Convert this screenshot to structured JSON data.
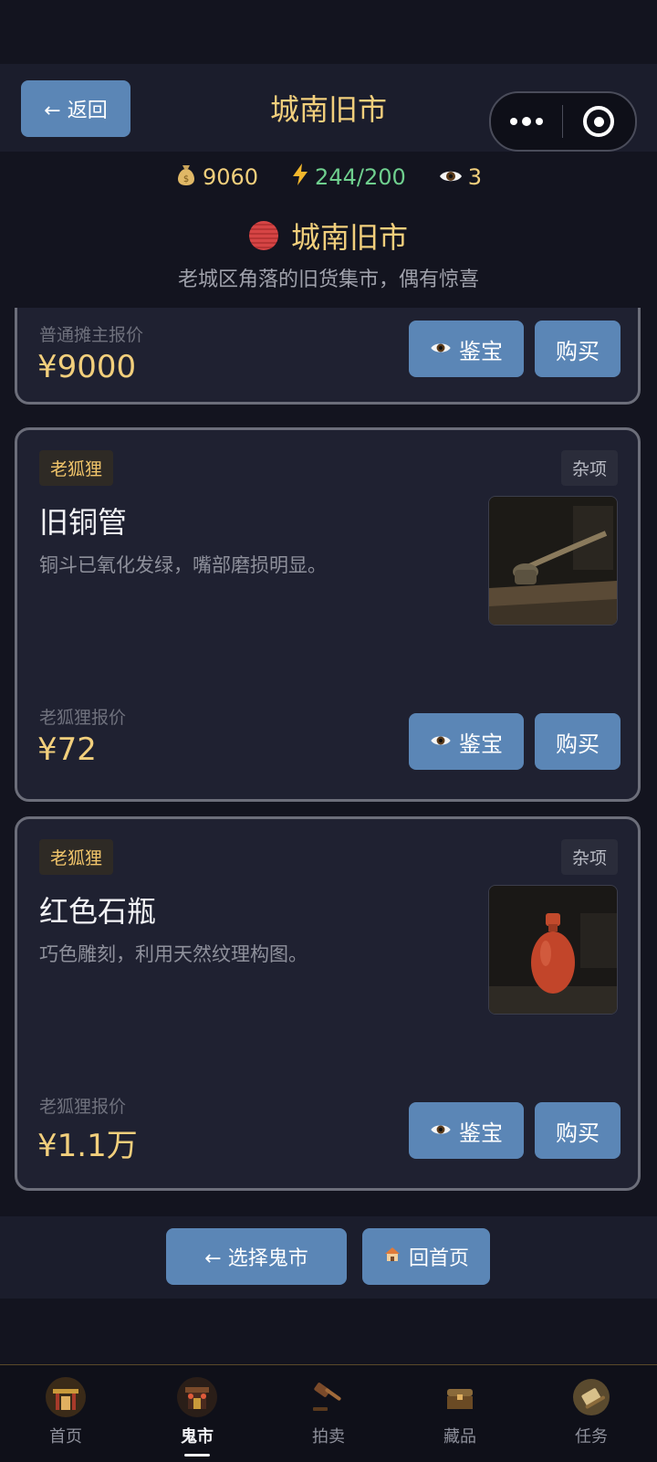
{
  "header": {
    "back_label": "← 返回",
    "title": "城南旧市"
  },
  "stats": {
    "money": "9060",
    "energy": "244/200",
    "views": "3"
  },
  "market": {
    "name": "城南旧市",
    "description": "老城区角落的旧货集市，偶有惊喜"
  },
  "items": [
    {
      "price_label": "普通摊主报价",
      "price": "¥9000",
      "appraise_label": "鉴宝",
      "buy_label": "购买"
    },
    {
      "seller_tag": "老狐狸",
      "category": "杂项",
      "name": "旧铜管",
      "description": "铜斗已氧化发绿，嘴部磨损明显。",
      "price_label": "老狐狸报价",
      "price": "¥72",
      "appraise_label": "鉴宝",
      "buy_label": "购买"
    },
    {
      "seller_tag": "老狐狸",
      "category": "杂项",
      "name": "红色石瓶",
      "description": "巧色雕刻，利用天然纹理构图。",
      "price_label": "老狐狸报价",
      "price": "¥1.1万",
      "appraise_label": "鉴宝",
      "buy_label": "购买"
    }
  ],
  "actions": {
    "select_market": "← 选择鬼市",
    "home": "回首页"
  },
  "tabbar": [
    {
      "label": "首页",
      "icon": "gate-icon"
    },
    {
      "label": "鬼市",
      "icon": "market-icon",
      "active": true
    },
    {
      "label": "拍卖",
      "icon": "gavel-icon"
    },
    {
      "label": "藏品",
      "icon": "chest-icon"
    },
    {
      "label": "任务",
      "icon": "scroll-icon"
    }
  ],
  "colors": {
    "accent_gold": "#f2cf7c",
    "button_blue": "#5b86b6",
    "energy_green": "#6fcf8e",
    "background": "#13141f"
  }
}
